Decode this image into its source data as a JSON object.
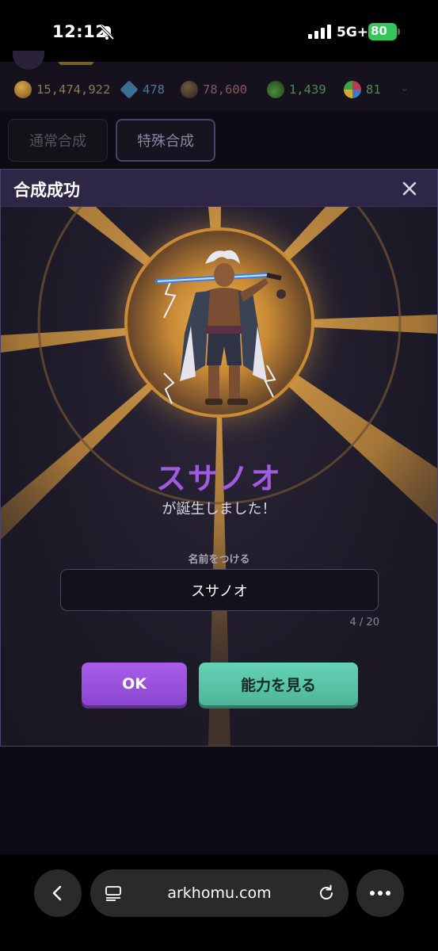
{
  "status_bar": {
    "time": "12:12",
    "network": "5G+",
    "battery": "80"
  },
  "resources": {
    "coins": "15,474,922",
    "gems": "478",
    "stones": "78,600",
    "potions": "1,439",
    "clovers": "81"
  },
  "tabs": [
    {
      "label": "通常合成"
    },
    {
      "label": "特殊合成"
    }
  ],
  "modal": {
    "title": "合成成功",
    "character_name": "スサノオ",
    "born_message": "が誕生しました！",
    "name_label": "名前をつける",
    "name_input_value": "スサノオ",
    "char_count": "4 / 20",
    "ok_label": "OK",
    "ability_label": "能力を見る"
  },
  "browser": {
    "url": "arkhomu.com"
  },
  "colors": {
    "accent_purple": "#a25ae0",
    "teal_button": "#5cc7a9",
    "ray_gold": "#d9a24a"
  }
}
